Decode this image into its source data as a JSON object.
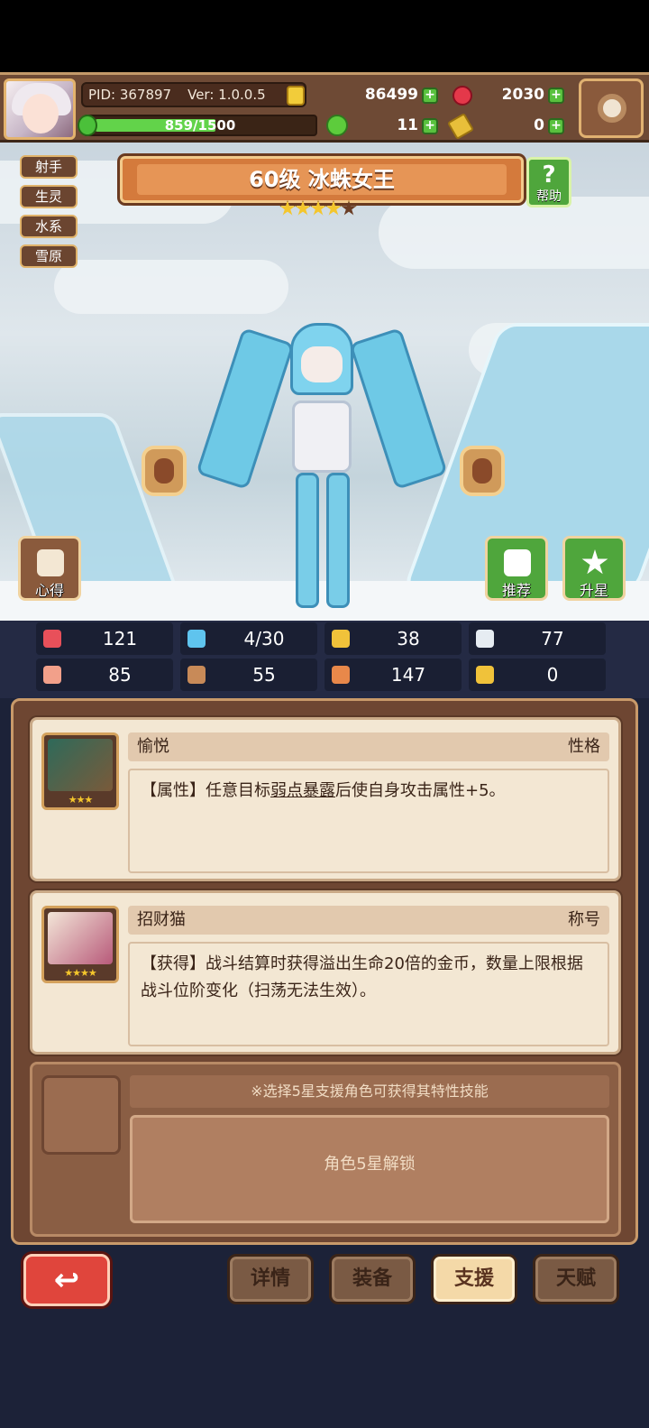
{
  "header": {
    "pid": "PID: 367897",
    "version": "Ver: 1.0.0.5",
    "coins": "86499",
    "gems": "2030",
    "xp": "859/1500",
    "xp_fraction": 0.573,
    "clover": "11",
    "keys": "0"
  },
  "tags": [
    "射手",
    "生灵",
    "水系",
    "雪原"
  ],
  "character": {
    "title": "60级 冰蛛女王",
    "stars": 4,
    "max_stars": 5
  },
  "buttons": {
    "help": "帮助",
    "notes": "心得",
    "recommend": "推荐",
    "star_up": "升星"
  },
  "stats": [
    {
      "icon": "heart-icon",
      "value": "121",
      "color": "#e8505a"
    },
    {
      "icon": "water-drop-icon",
      "value": "4/30",
      "color": "#5fc4ee"
    },
    {
      "icon": "shield-icon",
      "value": "38",
      "color": "#f0c23a"
    },
    {
      "icon": "wing-icon",
      "value": "77",
      "color": "#e6ecf2"
    },
    {
      "icon": "fist-icon",
      "value": "85",
      "color": "#f2a08a"
    },
    {
      "icon": "book-icon",
      "value": "55",
      "color": "#c88a58"
    },
    {
      "icon": "scroll-icon",
      "value": "147",
      "color": "#e8884a"
    },
    {
      "icon": "horseshoe-icon",
      "value": "0",
      "color": "#f0c23a"
    }
  ],
  "cards": [
    {
      "name": "愉悦",
      "type": "性格",
      "stars": "★★★",
      "desc_prefix": "【属性】任意目标",
      "desc_link": "弱点暴露",
      "desc_suffix": "后使自身攻击属性+5。"
    },
    {
      "name": "招财猫",
      "type": "称号",
      "stars": "★★★★",
      "desc": "【获得】战斗结算时获得溢出生命20倍的金币，数量上限根据战斗位阶变化（扫荡无法生效）。"
    }
  ],
  "support": {
    "hint": "※选择5星支援角色可获得其特性技能",
    "locked": "角色5星解锁"
  },
  "nav": {
    "back": "↩",
    "tabs": [
      "详情",
      "装备",
      "支援",
      "天赋"
    ],
    "active": "支援"
  }
}
